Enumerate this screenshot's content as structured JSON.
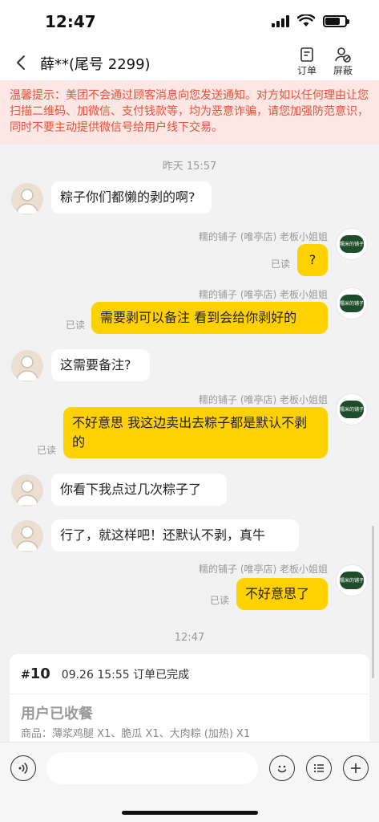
{
  "status": {
    "time": "12:47"
  },
  "nav": {
    "title": "薛**(尾号 2299)",
    "order_label": "订单",
    "block_label": "屏蔽"
  },
  "warning": {
    "text": "温馨提示：美团不会通过顾客消息向您发送通知。对方如以任何理由让您扫描二维码、加微信、支付钱款等，均为恶意诈骗，请您加强防范意识，同时不要主动提供微信号给用户线下交易。"
  },
  "chat": {
    "divider_1": "昨天 15:57",
    "divider_2": "12:47",
    "sender_name": "糯的铺子 (唯亭店) 老板小姐姐",
    "read_label": "已读",
    "shop_logo_text": "糯米的铺子",
    "messages": [
      {
        "side": "in",
        "text": "粽子你们都懒的剥的啊?"
      },
      {
        "side": "out",
        "text": "?"
      },
      {
        "side": "out",
        "text": "需要剥可以备注 看到会给你剥好的"
      },
      {
        "side": "in",
        "text": "这需要备注?"
      },
      {
        "side": "out",
        "text": "不好意思 我这边卖出去粽子都是默认不剥的"
      },
      {
        "side": "in",
        "text": "你看下我点过几次粽子了"
      },
      {
        "side": "in",
        "text": "行了，就这样吧！还默认不剥，真牛"
      },
      {
        "side": "out",
        "text": "不好意思了"
      }
    ]
  },
  "order": {
    "hash": "#",
    "number": "10",
    "meta": "09.26 15:55 订单已完成",
    "status": "用户已收餐",
    "goods": "商品：薄浆鸡腿 X1、脆瓜 X1、大肉粽 (加热) X1"
  },
  "input": {
    "placeholder": ""
  }
}
